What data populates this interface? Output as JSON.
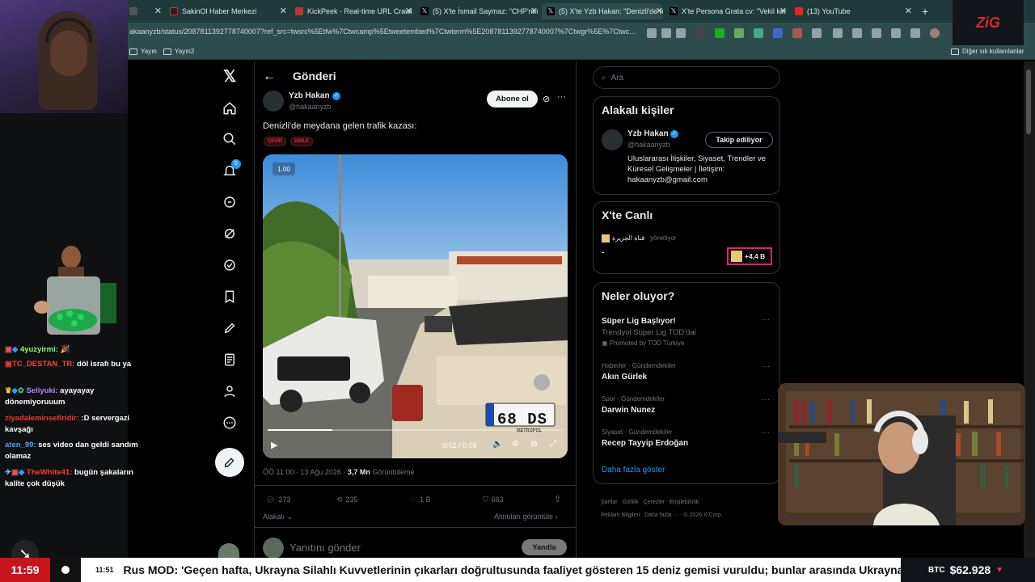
{
  "browser": {
    "tabs": [
      {
        "title": "",
        "x": 0
      },
      {
        "title": "SakinOl Haber Merkezi"
      },
      {
        "title": "KickPeek - Real-time URL Crawler"
      },
      {
        "title": "(5) X'te İsmail Saymaz: \"CHP'nin ..."
      },
      {
        "title": "(5) X'te Yzb Hakan: \"Denizli'de m..."
      },
      {
        "title": "X'te Persona Grata cv: \"Vekil kimi..."
      },
      {
        "title": "(13) YouTube"
      }
    ],
    "url": "akaanyzb/status/2087811392778740007?ref_src=twsrc%5Etfw%7Ctwcamp%5Etweetembed%7Ctwterm%5E2087811392778740007%7Ctwgr%5E%7Ctwc...",
    "bookmarks": [
      "Yayın",
      "Yayın2"
    ],
    "other_bookmarks": "Diğer sık kullanılanlar"
  },
  "stream": {
    "logo": "ZiG",
    "chat": [
      {
        "user": "4yuzyirmi:",
        "msg": "",
        "color": "#8cff6b"
      },
      {
        "user": "TC_DESTAN_TR:",
        "msg": "döl israfı bu ya",
        "color": "#ff3b3b"
      },
      {
        "user": "Seliyuki:",
        "msg": "ayayayay dönemiyoruuum",
        "color": "#c084fc"
      },
      {
        "user": "ziyadaleminsefiridir:",
        "msg": ":D servergazi kavşağı",
        "color": "#ff2d2d"
      },
      {
        "user": "aten_99:",
        "msg": "ses video dan geldi sandım olamaz",
        "color": "#4aa3ff"
      },
      {
        "user": "TheWhite41:",
        "msg": "bugün şakaların kalite çok düşük",
        "color": "#ff3b3b"
      }
    ],
    "clock": "11:59",
    "ticker_time": "11:51",
    "ticker_text": "Rus MOD: 'Geçen hafta, Ukrayna Silahlı Kuvvetlerinin çıkarları doğrultusunda faaliyet gösteren 15 deniz gemisi vuruldu; bunlar arasında Ukrayna Don",
    "btc_label": "BTC",
    "btc_value": "$62.928",
    "btc_arrow": "▼"
  },
  "x": {
    "header": "Gönderi",
    "author_name": "Yzb Hakan",
    "author_handle": "@hakaanyzb",
    "subscribe": "Abone ol",
    "tweet_text": "Denizli'de meydana gelen trafik kazası:",
    "chips": [
      "ÇEVİR",
      "DİNLE"
    ],
    "video": {
      "speed": "1.00",
      "time": "0:02 / 0:09",
      "plate": "68 DS",
      "brand": "METROPOL",
      "progress": 0.22
    },
    "meta_time": "ÖÖ 11:00 · 13 Ağu 2026 · ",
    "views": "3,7 Mn",
    "views_label": "Görüntüleme",
    "stats": {
      "replies": "273",
      "reposts": "235",
      "likes": "1 B",
      "bookmarks": "663"
    },
    "related": "Alakalı",
    "quotes": "Alıntıları görüntüle",
    "reply_placeholder": "Yanıtını gönder",
    "reply_button": "Yanıtla",
    "notif_count": "5"
  },
  "sidebar": {
    "search_placeholder": "Ara",
    "related_title": "Alakalı kişiler",
    "person_name": "Yzb Hakan",
    "person_handle": "@hakaanyzb",
    "following": "Takip ediliyor",
    "bio": "Uluslararası İlişkiler, Siyaset, Trendler ve Küresel Gelişmeler | İletişim: hakaanyzb@gmail.com",
    "live_title": "X'te Canlı",
    "live_host": "قناة الجزيرة",
    "live_role": "yönetiyor",
    "live_dash": "-",
    "live_count": "+4,4 B",
    "trends_title": "Neler oluyor?",
    "trends": [
      {
        "context": "",
        "title": "Süper Lig Başlıyor!",
        "sub": "Trendyol Süper Lig TOD'dal",
        "promo": "Promoted by TOD Türkiye"
      },
      {
        "context": "Haberler · Gündemdekiler",
        "title": "Akın Gürlek"
      },
      {
        "context": "Spor · Gündemdekiler",
        "title": "Darwin Nunez"
      },
      {
        "context": "Siyaset · Gündemdekiler",
        "title": "Recep Tayyip Erdoğan"
      }
    ],
    "show_more": "Daha fazla göster",
    "footer_links": [
      "Şartlar",
      "Gizlilik",
      "Çerezler",
      "Erişilebilirlik",
      "Reklam Bilgileri",
      "Daha fazla ···",
      "© 2026 X Corp."
    ]
  }
}
